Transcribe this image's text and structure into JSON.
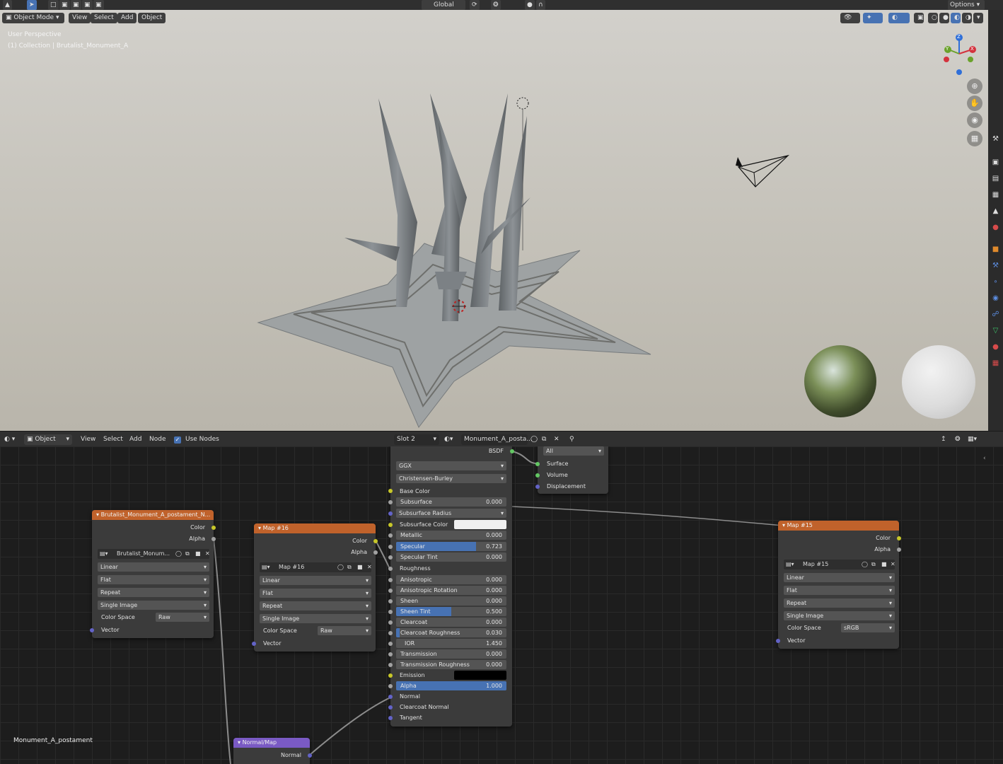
{
  "top_header": {
    "orientation": "Global",
    "options": "Options"
  },
  "viewport_header": {
    "mode": "Object Mode",
    "menus": [
      "View",
      "Select",
      "Add",
      "Object"
    ]
  },
  "viewport": {
    "perspective_label": "User Perspective",
    "collection_label": "(1) Collection | Brutalist_Monument_A",
    "gizmo": {
      "z": "Z",
      "y": "Y",
      "x": "X"
    }
  },
  "node_header": {
    "type": "Object",
    "menus": [
      "View",
      "Select",
      "Add",
      "Node"
    ],
    "use_nodes_label": "Use Nodes",
    "slot": "Slot 2",
    "material": "Monument_A_posta..."
  },
  "material_name_overlay": "Monument_A_postament",
  "nodes": {
    "tex1": {
      "title": "Brutalist_Monument_A_postament_N...",
      "out_color": "Color",
      "out_alpha": "Alpha",
      "image": "Brutalist_Monum...",
      "interpolation": "Linear",
      "projection": "Flat",
      "extension": "Repeat",
      "source": "Single Image",
      "color_space_label": "Color Space",
      "color_space": "Raw",
      "vector": "Vector"
    },
    "tex16": {
      "title": "Map #16",
      "out_color": "Color",
      "out_alpha": "Alpha",
      "image": "Map #16",
      "interpolation": "Linear",
      "projection": "Flat",
      "extension": "Repeat",
      "source": "Single Image",
      "color_space_label": "Color Space",
      "color_space": "Raw",
      "vector": "Vector"
    },
    "tex15": {
      "title": "Map #15",
      "out_color": "Color",
      "out_alpha": "Alpha",
      "image": "Map #15",
      "interpolation": "Linear",
      "projection": "Flat",
      "extension": "Repeat",
      "source": "Single Image",
      "color_space_label": "Color Space",
      "color_space": "sRGB",
      "vector": "Vector"
    },
    "bsdf": {
      "out_label": "BSDF",
      "distribution": "GGX",
      "subsurface_method": "Christensen-Burley",
      "base_color": "Base Color",
      "subsurface_radius": "Subsurface Radius",
      "subsurface_color": "Subsurface Color",
      "roughness": "Roughness",
      "emission": "Emission",
      "normal": "Normal",
      "clearcoat_normal": "Clearcoat Normal",
      "tangent": "Tangent",
      "params": [
        {
          "label": "Subsurface",
          "value": "0.000",
          "fill": 0
        },
        {
          "label": "Metallic",
          "value": "0.000",
          "fill": 0
        },
        {
          "label": "Specular",
          "value": "0.723",
          "fill": 0.723
        },
        {
          "label": "Specular Tint",
          "value": "0.000",
          "fill": 0
        },
        {
          "label": "Anisotropic",
          "value": "0.000",
          "fill": 0
        },
        {
          "label": "Anisotropic Rotation",
          "value": "0.000",
          "fill": 0
        },
        {
          "label": "Sheen",
          "value": "0.000",
          "fill": 0
        },
        {
          "label": "Sheen Tint",
          "value": "0.500",
          "fill": 0.5
        },
        {
          "label": "Clearcoat",
          "value": "0.000",
          "fill": 0
        },
        {
          "label": "Clearcoat Roughness",
          "value": "0.030",
          "fill": 0.03
        },
        {
          "label": "IOR",
          "value": "1.450",
          "fill": 0
        },
        {
          "label": "Transmission",
          "value": "0.000",
          "fill": 0
        },
        {
          "label": "Transmission Roughness",
          "value": "0.000",
          "fill": 0
        },
        {
          "label": "Alpha",
          "value": "1.000",
          "fill": 1
        }
      ]
    },
    "output": {
      "target": "All",
      "surface": "Surface",
      "volume": "Volume",
      "displacement": "Displacement"
    },
    "normal_map": {
      "title": "Normal/Map",
      "out_normal": "Normal"
    }
  }
}
